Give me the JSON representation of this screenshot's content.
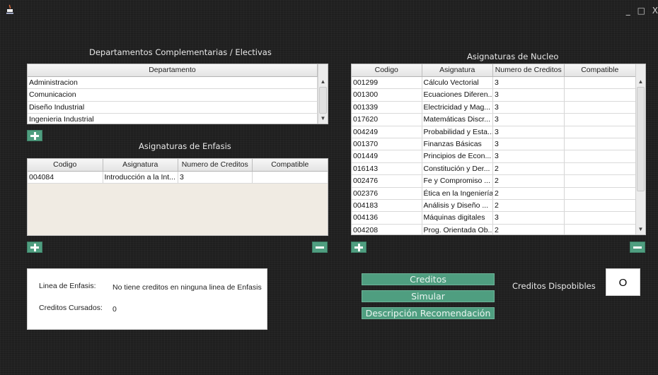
{
  "window": {
    "controls": [
      "_",
      "□",
      "X"
    ]
  },
  "departamentos": {
    "caption": "Departamentos Complementarias / Electivas",
    "header": "Departamento",
    "rows": [
      "Administracion",
      "Comunicacion",
      "Diseño Industrial",
      "Ingenieria Industrial"
    ]
  },
  "enfasis": {
    "caption": "Asignaturas de Enfasis",
    "headers": [
      "Codigo",
      "Asignatura",
      "Numero de Creditos",
      "Compatible"
    ],
    "rows": [
      [
        "004084",
        "Introducción a la Int...",
        "3",
        ""
      ]
    ]
  },
  "nucleo": {
    "caption": "Asignaturas de Nucleo",
    "headers": [
      "Codigo",
      "Asignatura",
      "Numero de Creditos",
      "Compatible"
    ],
    "rows": [
      [
        "001299",
        "Cálculo Vectorial",
        "3",
        ""
      ],
      [
        "001300",
        "Ecuaciones Diferen...",
        "3",
        ""
      ],
      [
        "001339",
        "Electricidad y Mag...",
        "3",
        ""
      ],
      [
        "017620",
        "Matemáticas Discr...",
        "3",
        ""
      ],
      [
        "004249",
        "Probabilidad y Esta...",
        "3",
        ""
      ],
      [
        "001370",
        "Finanzas Básicas",
        "3",
        ""
      ],
      [
        "001449",
        "Principios de Econ...",
        "3",
        ""
      ],
      [
        "016143",
        "Constitución y Der...",
        "2",
        ""
      ],
      [
        "002476",
        "Fe y Compromiso ...",
        "2",
        ""
      ],
      [
        "002376",
        "Ética en la Ingeniería",
        "2",
        ""
      ],
      [
        "004183",
        "Análisis y Diseño ...",
        "2",
        ""
      ],
      [
        "004136",
        "Máquinas digitales",
        "3",
        ""
      ],
      [
        "004208",
        "Prog. Orientada Ob...",
        "2",
        ""
      ]
    ]
  },
  "info": {
    "linea_label": "Linea de Enfasis:",
    "linea_value": "No tiene creditos en ninguna linea de Enfasis",
    "cursados_label": "Creditos Cursados:",
    "cursados_value": "0"
  },
  "buttons": {
    "creditos": "Creditos",
    "simular": "Simular",
    "descripcion": "Descripción Recomendación"
  },
  "disponibles": {
    "label": "Creditos Dispobibles",
    "value": "O"
  },
  "colors": {
    "accent_green": "#4f9e80",
    "background": "#222222"
  }
}
